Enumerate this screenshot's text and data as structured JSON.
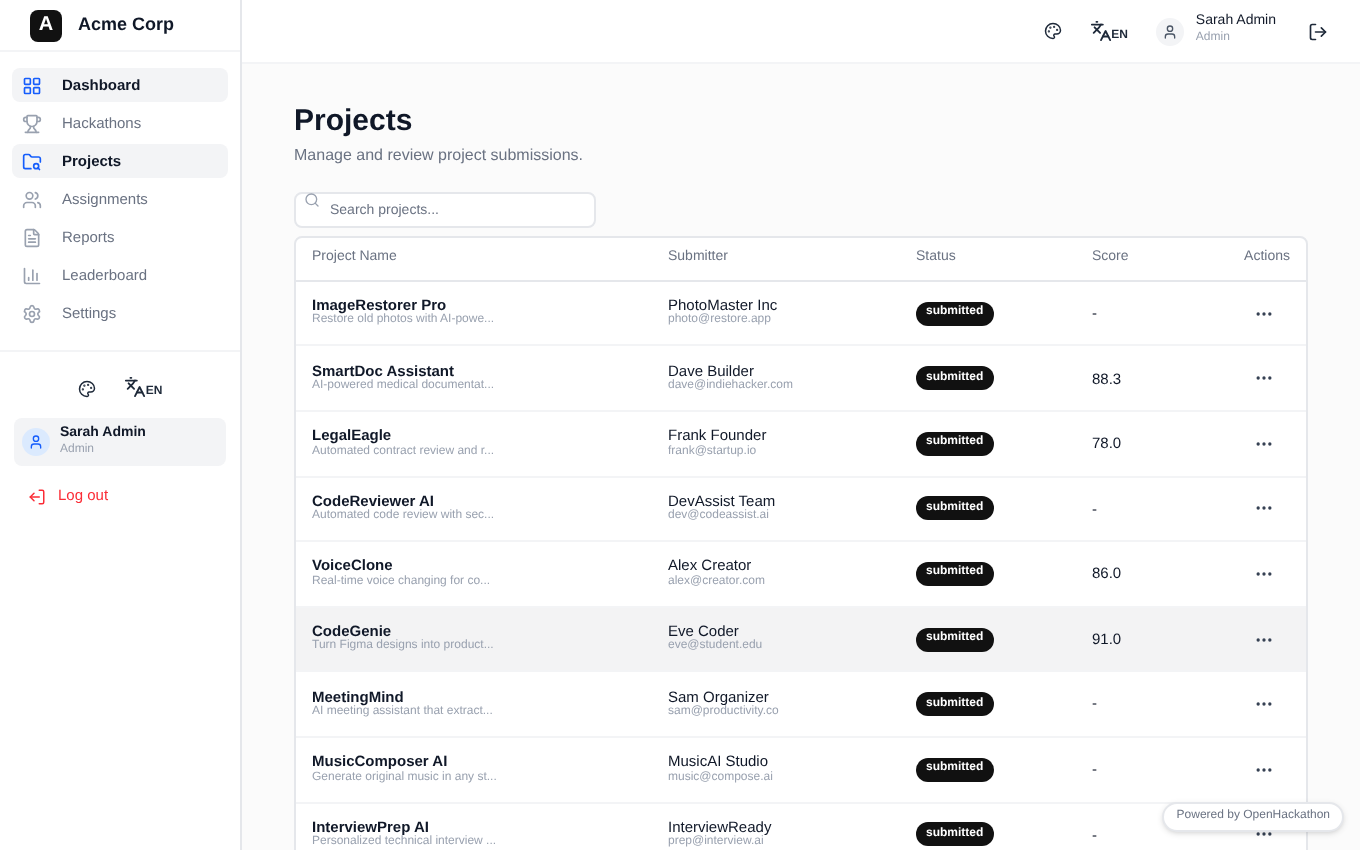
{
  "brand": {
    "logo": "A",
    "name": "Acme Corp"
  },
  "sidebar": {
    "items": [
      {
        "kind": "dashboard",
        "label": "Dashboard",
        "selected": true
      },
      {
        "kind": "hackathons",
        "label": "Hackathons",
        "selected": false
      },
      {
        "kind": "projects",
        "label": "Projects",
        "selected": true
      },
      {
        "kind": "assignments",
        "label": "Assignments",
        "selected": false
      },
      {
        "kind": "reports",
        "label": "Reports",
        "selected": false
      },
      {
        "kind": "leaderboard",
        "label": "Leaderboard",
        "selected": false
      },
      {
        "kind": "settings",
        "label": "Settings",
        "selected": false
      }
    ],
    "language": "EN",
    "user": {
      "name": "Sarah Admin",
      "role": "Admin"
    },
    "logout": "Log out"
  },
  "header": {
    "language": "EN",
    "user": {
      "name": "Sarah Admin",
      "role": "Admin"
    }
  },
  "page": {
    "title": "Projects",
    "subtitle": "Manage and review project submissions.",
    "search": {
      "placeholder": "Search projects..."
    }
  },
  "table": {
    "columns": [
      "Project Name",
      "Submitter",
      "Status",
      "Score",
      "Actions"
    ],
    "rows": [
      {
        "name": "ImageRestorer Pro",
        "description": "Restore old photos with AI-powe...",
        "submitter": "PhotoMaster Inc",
        "email": "photo@restore.app",
        "status": "submitted",
        "score": "-",
        "highlighted": false
      },
      {
        "name": "SmartDoc Assistant",
        "description": "AI-powered medical documentat...",
        "submitter": "Dave Builder",
        "email": "dave@indiehacker.com",
        "status": "submitted",
        "score": "88.3",
        "highlighted": false
      },
      {
        "name": "LegalEagle",
        "description": "Automated contract review and r...",
        "submitter": "Frank Founder",
        "email": "frank@startup.io",
        "status": "submitted",
        "score": "78.0",
        "highlighted": false
      },
      {
        "name": "CodeReviewer AI",
        "description": "Automated code review with sec...",
        "submitter": "DevAssist Team",
        "email": "dev@codeassist.ai",
        "status": "submitted",
        "score": "-",
        "highlighted": false
      },
      {
        "name": "VoiceClone",
        "description": "Real-time voice changing for co...",
        "submitter": "Alex Creator",
        "email": "alex@creator.com",
        "status": "submitted",
        "score": "86.0",
        "highlighted": false
      },
      {
        "name": "CodeGenie",
        "description": "Turn Figma designs into product...",
        "submitter": "Eve Coder",
        "email": "eve@student.edu",
        "status": "submitted",
        "score": "91.0",
        "highlighted": true
      },
      {
        "name": "MeetingMind",
        "description": "AI meeting assistant that extract...",
        "submitter": "Sam Organizer",
        "email": "sam@productivity.co",
        "status": "submitted",
        "score": "-",
        "highlighted": false
      },
      {
        "name": "MusicComposer AI",
        "description": "Generate original music in any st...",
        "submitter": "MusicAI Studio",
        "email": "music@compose.ai",
        "status": "submitted",
        "score": "-",
        "highlighted": false
      },
      {
        "name": "InterviewPrep AI",
        "description": "Personalized technical interview ...",
        "submitter": "InterviewReady",
        "email": "prep@interview.ai",
        "status": "submitted",
        "score": "-",
        "highlighted": false
      }
    ]
  },
  "footer_badge": "Powered by OpenHackathon"
}
